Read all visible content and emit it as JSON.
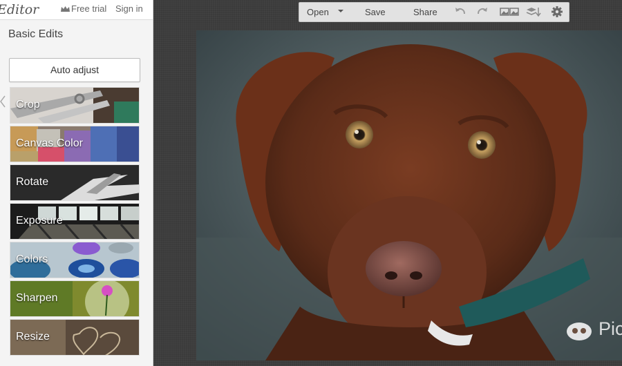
{
  "app": {
    "logo_text": "Editor"
  },
  "topbar": {
    "free_trial": "Free trial",
    "sign_in": "Sign in"
  },
  "panel": {
    "title": "Basic Edits",
    "auto_adjust": "Auto adjust"
  },
  "tools": [
    {
      "label": "Crop"
    },
    {
      "label": "Canvas Color"
    },
    {
      "label": "Rotate"
    },
    {
      "label": "Exposure"
    },
    {
      "label": "Colors"
    },
    {
      "label": "Sharpen"
    },
    {
      "label": "Resize"
    }
  ],
  "toolbar": {
    "open": "Open",
    "save": "Save",
    "share": "Share"
  },
  "watermark": {
    "text": "Pic"
  },
  "colors": {
    "workspace_bg": "#3b3b3b",
    "panel_bg": "#f4f4f4",
    "toolbar_bg": "#e2e2e2"
  }
}
